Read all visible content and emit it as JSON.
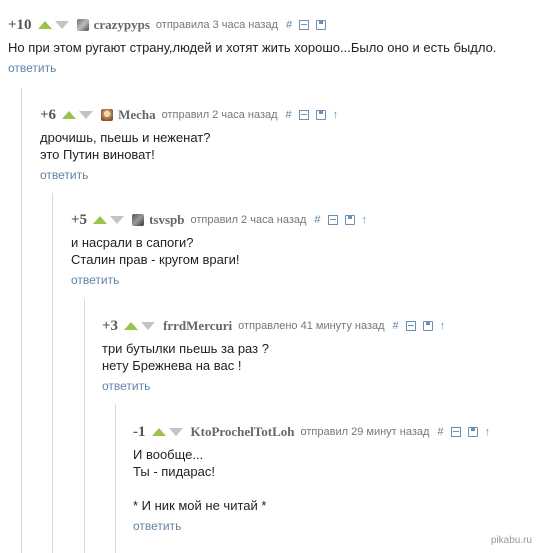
{
  "comments": [
    {
      "rating": "+10",
      "author": "crazypyps",
      "meta": "отправила 3 часа назад",
      "lines": [
        "Но при этом ругают страну,людей и хотят жить хорошо...Было оно и есть быдло."
      ],
      "reply": "ответить"
    },
    {
      "rating": "+6",
      "author": "Mecha",
      "meta": "отправил 2 часа назад",
      "lines": [
        "дрочишь, пьешь и неженат?",
        "это Путин виноват!"
      ],
      "reply": "ответить"
    },
    {
      "rating": "+5",
      "author": "tsvspb",
      "meta": "отправил 2 часа назад",
      "lines": [
        "и насрали в сапоги?",
        "Сталин прав - кругом враги!"
      ],
      "reply": "ответить"
    },
    {
      "rating": "+3",
      "author": "frrdMercuri",
      "meta": "отправлено 41 минуту назад",
      "lines": [
        "три бутылки пьешь за раз ?",
        "нету Брежнева на вас !"
      ],
      "reply": "ответить"
    },
    {
      "rating": "-1",
      "author": "KtoProchelTotLoh",
      "meta": "отправил 29 минут назад",
      "lines": [
        "И вообще...",
        "Ты - пидарас!",
        "",
        "* И ник мой не читай *"
      ],
      "reply": "ответить"
    }
  ],
  "tools": {
    "hash": "#",
    "up": "↑"
  },
  "watermark": "pikabu.ru",
  "colors": {
    "vote_up": "#9bc34a",
    "vote_down": "#c4c4c4",
    "link": "#5f83a8",
    "thread_line": "#d6dbe0"
  }
}
